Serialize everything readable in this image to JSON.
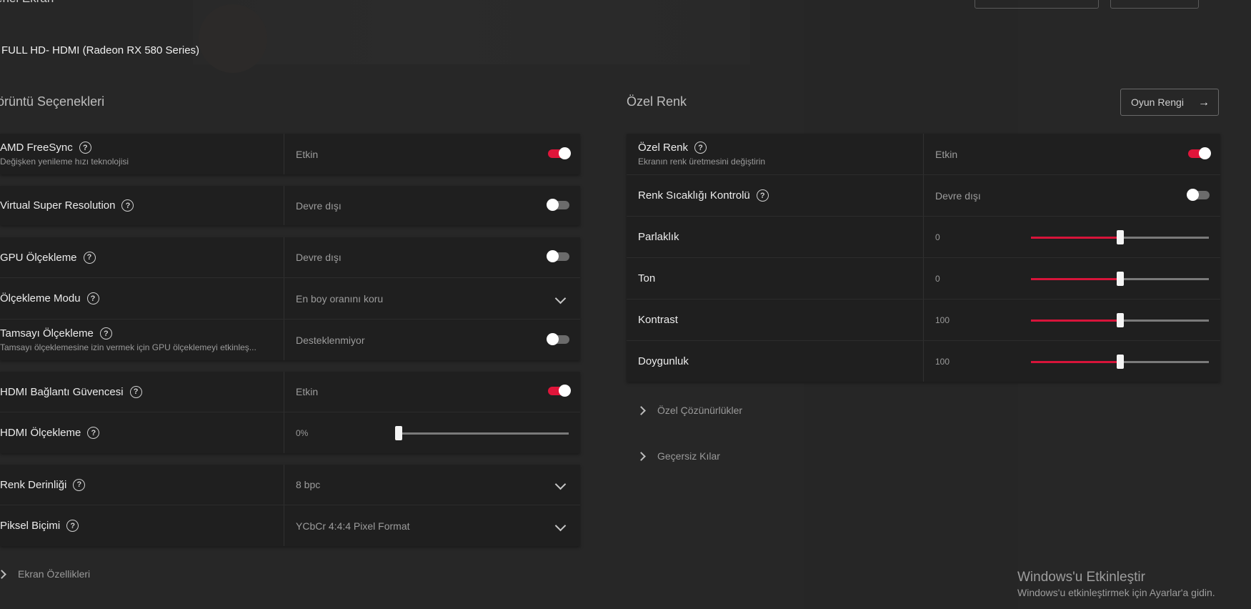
{
  "page": {
    "title": "enel Ekran",
    "display_name": "FULL HD- HDMI (Radeon RX 580 Series)"
  },
  "left": {
    "section_title": "örüntü Seçenekleri",
    "rows": [
      {
        "label": "AMD FreeSync",
        "sub": "Değişken yenileme hızı teknolojisi",
        "value": "Etkin",
        "control": "toggle",
        "on": true
      },
      {
        "label": "Virtual Super Resolution",
        "value": "Devre dışı",
        "control": "toggle",
        "on": false
      },
      {
        "label": "GPU Ölçekleme",
        "value": "Devre dışı",
        "control": "toggle",
        "on": false
      },
      {
        "label": "Ölçekleme Modu",
        "value": "En boy oranını koru",
        "control": "dropdown"
      },
      {
        "label": "Tamsayı Ölçekleme",
        "sub": "Tamsayı ölçeklemesine izin vermek için GPU ölçeklemeyi etkinleş...",
        "value": "Desteklenmiyor",
        "control": "toggle",
        "on": false
      },
      {
        "label": "HDMI Bağlantı Güvencesi",
        "value": "Etkin",
        "control": "toggle",
        "on": true
      },
      {
        "label": "HDMI Ölçekleme",
        "value": "0%",
        "control": "slider",
        "level": 0
      },
      {
        "label": "Renk Derinliği",
        "value": "8 bpc",
        "control": "dropdown"
      },
      {
        "label": "Piksel Biçimi",
        "value": "YCbCr 4:4:4 Pixel Format",
        "control": "dropdown"
      }
    ],
    "expander": "Ekran Özellikleri"
  },
  "right": {
    "section_title": "Özel Renk",
    "game_button": "Oyun Rengi",
    "rows": [
      {
        "label": "Özel Renk",
        "sub": "Ekranın renk üretmesini değiştirin",
        "value": "Etkin",
        "control": "toggle",
        "on": true
      },
      {
        "label": "Renk Sıcaklığı Kontrolü",
        "value": "Devre dışı",
        "control": "toggle",
        "on": false
      },
      {
        "label": "Parlaklık",
        "value": "0",
        "control": "slider",
        "level": 0.5
      },
      {
        "label": "Ton",
        "value": "0",
        "control": "slider",
        "level": 0.5
      },
      {
        "label": "Kontrast",
        "value": "100",
        "control": "slider",
        "level": 0.5
      },
      {
        "label": "Doygunluk",
        "value": "100",
        "control": "slider",
        "level": 0.5
      }
    ],
    "expanders": [
      "Özel Çözünürlükler",
      "Geçersiz Kılar"
    ]
  },
  "watermark": {
    "title": "Windows'u Etkinleştir",
    "subtitle": "Windows'u etkinleştirmek için Ayarlar'a gidin."
  },
  "colors": {
    "accent": "#e0153a",
    "panel": "#1f1f1f",
    "background": "#272727"
  }
}
